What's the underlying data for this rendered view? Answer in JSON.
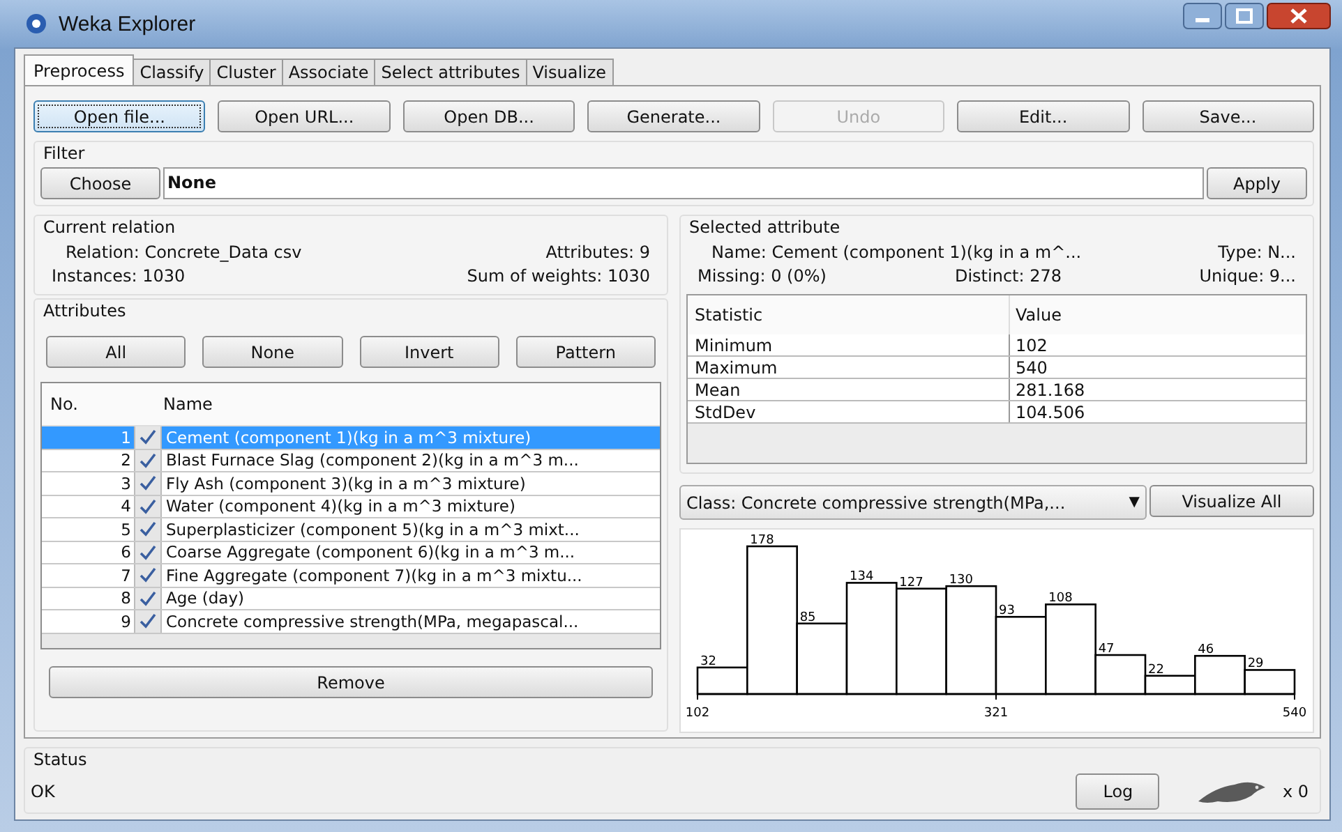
{
  "window": {
    "title": "Weka Explorer"
  },
  "tabs": [
    {
      "label": "Preprocess",
      "selected": true
    },
    {
      "label": "Classify",
      "selected": false
    },
    {
      "label": "Cluster",
      "selected": false
    },
    {
      "label": "Associate",
      "selected": false
    },
    {
      "label": "Select attributes",
      "selected": false
    },
    {
      "label": "Visualize",
      "selected": false
    }
  ],
  "toolbar": [
    {
      "label": "Open file...",
      "disabled": false,
      "focused": true
    },
    {
      "label": "Open URL...",
      "disabled": false,
      "focused": false
    },
    {
      "label": "Open DB...",
      "disabled": false,
      "focused": false
    },
    {
      "label": "Generate...",
      "disabled": false,
      "focused": false
    },
    {
      "label": "Undo",
      "disabled": true,
      "focused": false
    },
    {
      "label": "Edit...",
      "disabled": false,
      "focused": false
    },
    {
      "label": "Save...",
      "disabled": false,
      "focused": false
    }
  ],
  "filter": {
    "title": "Filter",
    "choose": "Choose",
    "value": "None",
    "apply": "Apply"
  },
  "current_relation": {
    "title": "Current relation",
    "relation": "Relation: Concrete_Data csv",
    "attributes": "Attributes: 9",
    "instances": "Instances: 1030",
    "weights": "Sum of weights: 1030"
  },
  "attributes": {
    "title": "Attributes",
    "buttons": [
      "All",
      "None",
      "Invert",
      "Pattern"
    ],
    "columns": [
      "No.",
      "Name"
    ],
    "rows": [
      {
        "no": "1",
        "checked": true,
        "selected": true,
        "name": "Cement (component 1)(kg in a m^3 mixture)"
      },
      {
        "no": "2",
        "checked": true,
        "selected": false,
        "name": "Blast Furnace Slag (component 2)(kg in a m^3 m..."
      },
      {
        "no": "3",
        "checked": true,
        "selected": false,
        "name": "Fly Ash (component 3)(kg in a m^3 mixture)"
      },
      {
        "no": "4",
        "checked": true,
        "selected": false,
        "name": "Water  (component 4)(kg in a m^3 mixture)"
      },
      {
        "no": "5",
        "checked": true,
        "selected": false,
        "name": "Superplasticizer (component 5)(kg in a m^3 mixt..."
      },
      {
        "no": "6",
        "checked": true,
        "selected": false,
        "name": "Coarse Aggregate  (component 6)(kg in a m^3 m..."
      },
      {
        "no": "7",
        "checked": true,
        "selected": false,
        "name": "Fine Aggregate (component 7)(kg in a m^3 mixtu..."
      },
      {
        "no": "8",
        "checked": true,
        "selected": false,
        "name": "Age (day)"
      },
      {
        "no": "9",
        "checked": true,
        "selected": false,
        "name": "Concrete compressive strength(MPa, megapascal..."
      }
    ],
    "remove": "Remove"
  },
  "selected_attribute": {
    "title": "Selected attribute",
    "name": "Name: Cement (component 1)(kg in a m^...",
    "type": "Type: N...",
    "missing": "Missing: 0 (0%)",
    "distinct": "Distinct: 278",
    "unique": "Unique: 9...",
    "columns": [
      "Statistic",
      "Value"
    ],
    "rows": [
      {
        "statistic": "Minimum",
        "value": "102"
      },
      {
        "statistic": "Maximum",
        "value": "540"
      },
      {
        "statistic": "Mean",
        "value": "281.168"
      },
      {
        "statistic": "StdDev",
        "value": "104.506"
      }
    ]
  },
  "class_select": {
    "value": "Class: Concrete compressive strength(MPa,...",
    "caret": "▼"
  },
  "visualize_all": "Visualize All",
  "histogram": {
    "chart_data": {
      "type": "bar",
      "x": [
        120.25,
        156.75,
        193.25,
        229.75,
        266.25,
        302.75,
        339.25,
        375.75,
        412.25,
        448.75,
        485.25,
        521.75
      ],
      "values": [
        32,
        178,
        85,
        134,
        127,
        130,
        93,
        108,
        47,
        22,
        46,
        29
      ],
      "data_labels": true,
      "xlim": [
        102,
        540
      ],
      "xticks": [
        {
          "value": 102,
          "label": "102"
        },
        {
          "value": 321,
          "label": "321"
        },
        {
          "value": 540,
          "label": "540"
        }
      ]
    }
  },
  "status": {
    "title": "Status",
    "text": "OK",
    "log": "Log",
    "count": "x 0"
  }
}
